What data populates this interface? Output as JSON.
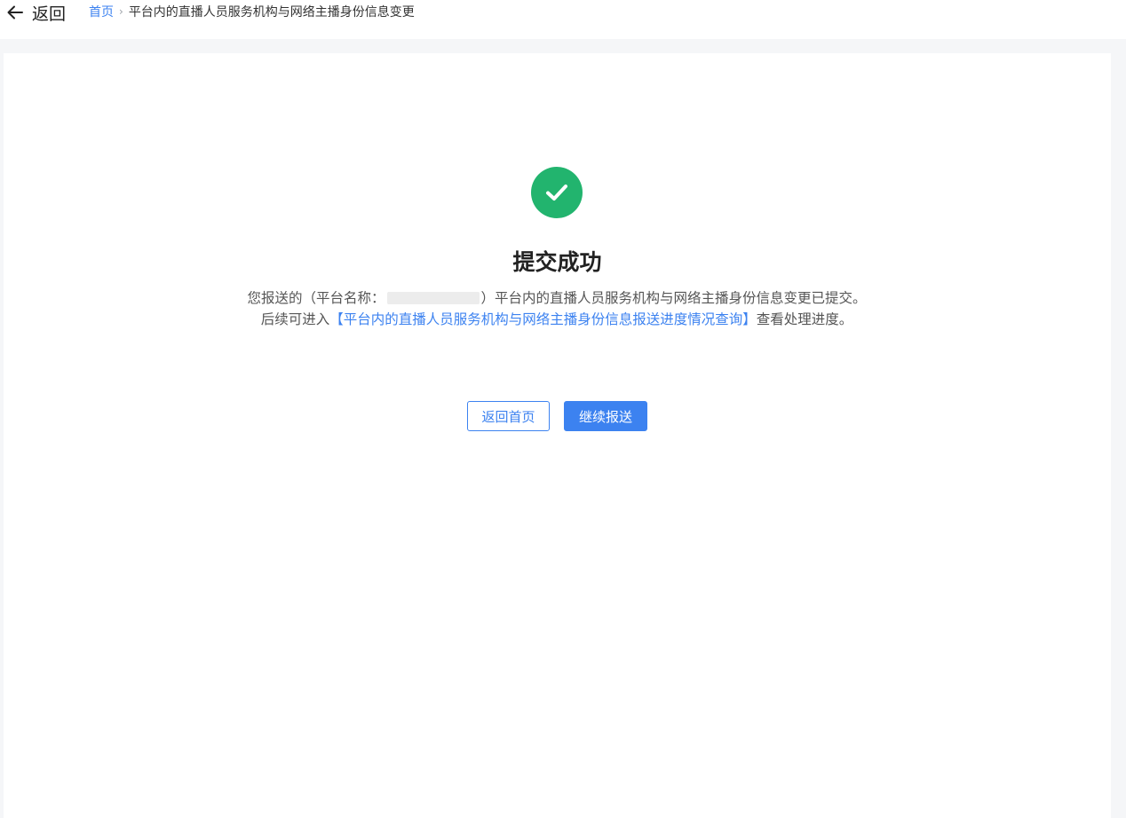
{
  "header": {
    "back_label": "返回",
    "breadcrumb": {
      "home": "首页",
      "separator": "›",
      "current": "平台内的直播人员服务机构与网络主播身份信息变更"
    }
  },
  "result": {
    "status_icon": "check-circle-icon",
    "title": "提交成功",
    "message_prefix": "您报送的（平台名称：",
    "message_suffix": "）平台内的直播人员服务机构与网络主播身份信息变更已提交。",
    "followup_prefix": "后续可进入",
    "followup_link": "【平台内的直播人员服务机构与网络主播身份信息报送进度情况查询】",
    "followup_suffix": "查看处理进度。"
  },
  "actions": {
    "home_button": "返回首页",
    "continue_button": "继续报送"
  },
  "colors": {
    "accent": "#3c82f0",
    "success": "#22b46e"
  }
}
